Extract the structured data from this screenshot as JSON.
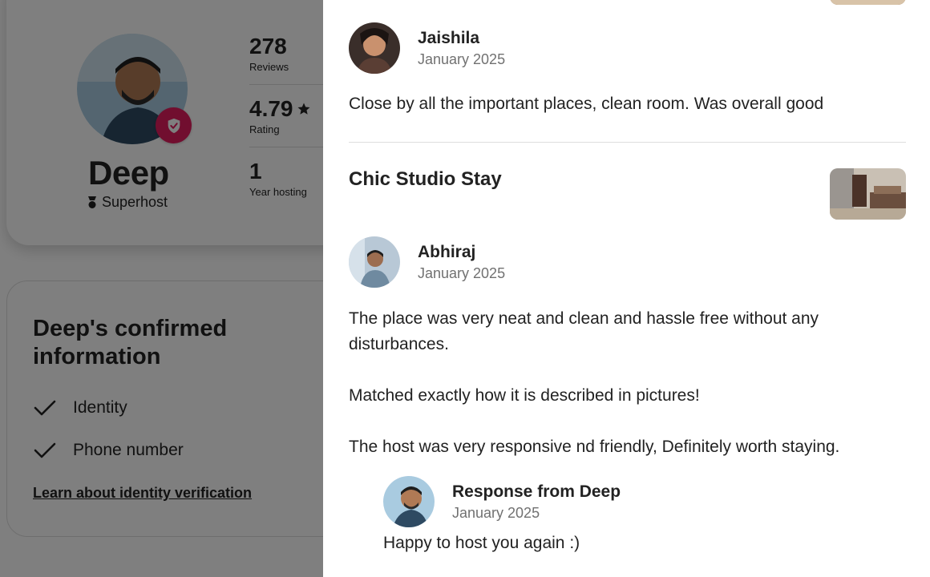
{
  "profile": {
    "name": "Deep",
    "badge_label": "Superhost",
    "stats": [
      {
        "value": "278",
        "label": "Reviews"
      },
      {
        "value": "4.79",
        "label": "Rating",
        "icon": "star-icon"
      },
      {
        "value": "1",
        "label": "Year hosting"
      }
    ]
  },
  "confirmed_info": {
    "title": "Deep's confirmed information",
    "items": [
      {
        "label": "Identity",
        "icon": "check-icon"
      },
      {
        "label": "Phone number",
        "icon": "check-icon"
      }
    ],
    "link": "Learn about identity verification"
  },
  "reviews": [
    {
      "reviewer": "Jaishila",
      "date": "January 2025",
      "text": "Close by all the important places, clean room. Was overall good"
    },
    {
      "listing_title": "Chic Studio Stay",
      "reviewer": "Abhiraj",
      "date": "January 2025",
      "paragraphs": [
        "The place was very neat and clean and hassle free without any disturbances.",
        "Matched exactly how it is described in pictures!",
        "The host was very responsive nd friendly, Definitely worth staying."
      ],
      "response": {
        "title": "Response from Deep",
        "date": "January 2025",
        "text": "Happy to host you again :)"
      }
    }
  ],
  "colors": {
    "accent": "#e31c5f",
    "text": "#222222",
    "secondary_text": "#717171",
    "divider": "#dddddd"
  }
}
